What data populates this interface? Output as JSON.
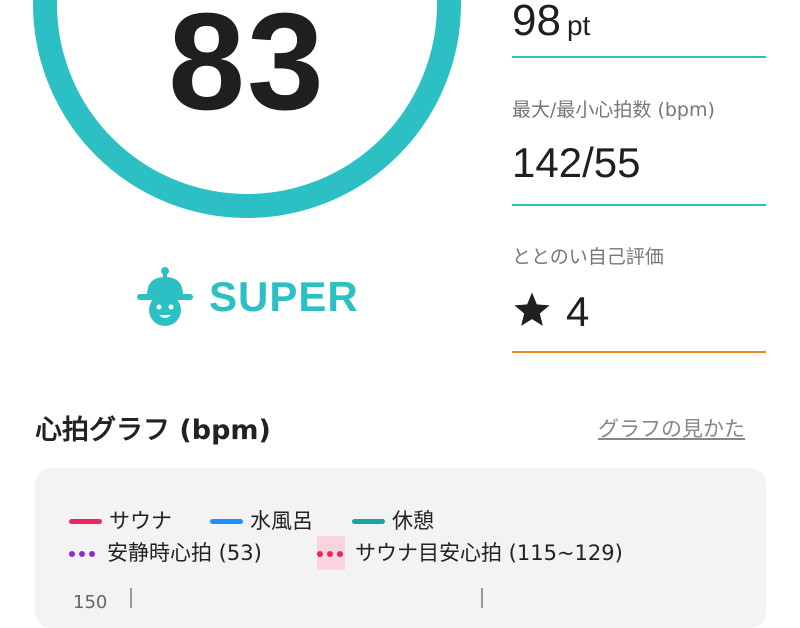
{
  "score": {
    "value": "83",
    "rank": "SUPER"
  },
  "stats": {
    "points": {
      "value": "98",
      "unit": "pt"
    },
    "heart_rate": {
      "label": "最大/最小心拍数 (bpm)",
      "value": "142/55"
    },
    "rating": {
      "label": "ととのい自己評価",
      "value": "4"
    }
  },
  "graph": {
    "title": "心拍グラフ (bpm)",
    "help_link": "グラフの見かた",
    "legend": {
      "sauna": "サウナ",
      "cold_bath": "水風呂",
      "rest": "休憩",
      "resting_hr": "安静時心拍 (53)",
      "sauna_target": "サウナ目安心拍 (115~129)"
    },
    "axis_label_partial": "150"
  },
  "colors": {
    "accent": "#2cc0c5",
    "rating_line": "#f08a1f",
    "sauna": "#f0245c",
    "cold_bath": "#1e8fff",
    "rest": "#1aa3a3",
    "resting_hr": "#8a2be2",
    "sauna_target": "#f0245c",
    "sauna_target_zone": "#f9d3dd"
  },
  "icons": {
    "rank": "bell-hat-mascot-icon",
    "rating": "star-icon"
  }
}
